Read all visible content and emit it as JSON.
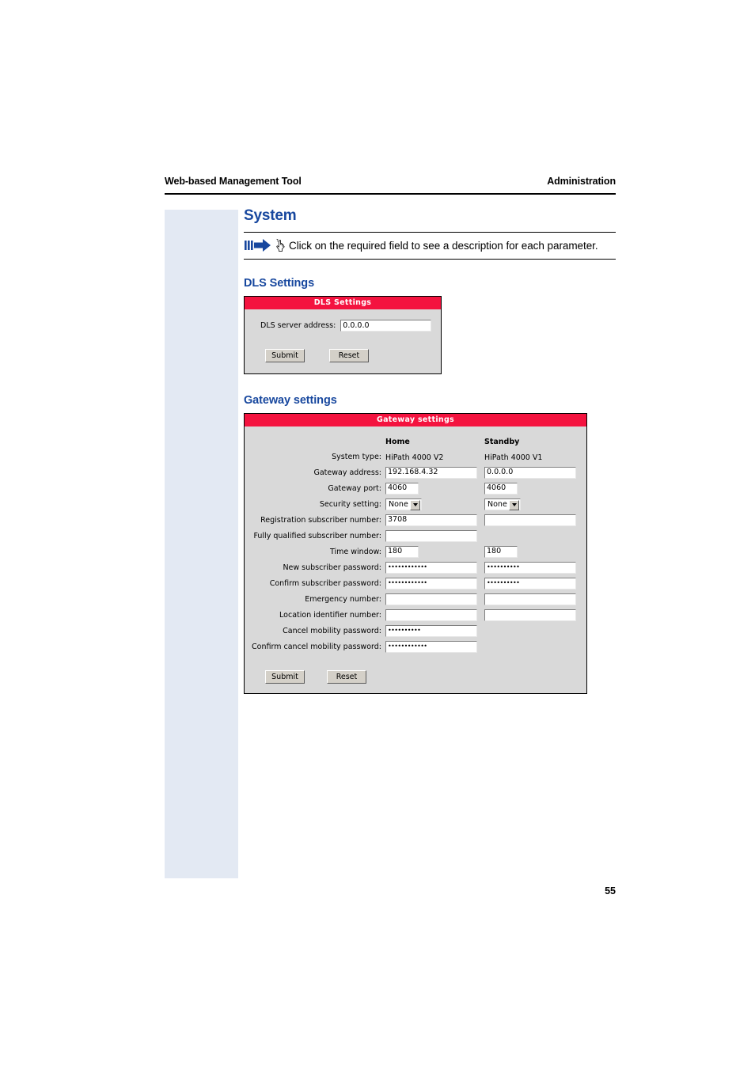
{
  "document": {
    "header_left": "Web-based Management Tool",
    "header_right": "Administration",
    "page_number": "55",
    "section_title": "System",
    "note_text": "Click on the required field to see a description for each parameter.",
    "note_icon": "arrow-bars-icon",
    "note_cursor_icon": "pointing-hand-cursor-icon",
    "accent_color": "#17479e",
    "panel_title_color": "#f4133f",
    "sidebar_color": "#e3e9f3"
  },
  "dls_section": {
    "heading": "DLS Settings",
    "panel_title": "DLS Settings",
    "fields": [
      {
        "label": "DLS server address:",
        "value": "0.0.0.0"
      }
    ],
    "buttons": {
      "submit": "Submit",
      "reset": "Reset"
    }
  },
  "gateway_section": {
    "heading": "Gateway settings",
    "panel_title": "Gateway settings",
    "columns": {
      "home": "Home",
      "standby": "Standby"
    },
    "rows": [
      {
        "label": "System type:",
        "type": "static",
        "home": "HiPath 4000 V2",
        "standby": "HiPath 4000 V1"
      },
      {
        "label": "Gateway address:",
        "type": "text",
        "width": "wide",
        "home": "192.168.4.32",
        "standby": "0.0.0.0"
      },
      {
        "label": "Gateway port:",
        "type": "text",
        "width": "narrow",
        "home": "4060",
        "standby": "4060"
      },
      {
        "label": "Security setting:",
        "type": "select",
        "home": "None",
        "standby": "None",
        "options": [
          "None"
        ]
      },
      {
        "label": "Registration subscriber number:",
        "type": "text",
        "width": "wide",
        "home": "3708",
        "standby": ""
      },
      {
        "label": "Fully qualified subscriber number:",
        "type": "text",
        "width": "wide",
        "home": "",
        "standby": null
      },
      {
        "label": "Time window:",
        "type": "text",
        "width": "narrow",
        "home": "180",
        "standby": "180"
      },
      {
        "label": "New subscriber password:",
        "type": "password",
        "width": "wide",
        "home": "••••••••••••",
        "standby": "••••••••••"
      },
      {
        "label": "Confirm subscriber password:",
        "type": "password",
        "width": "wide",
        "home": "••••••••••••",
        "standby": "••••••••••"
      },
      {
        "label": "Emergency number:",
        "type": "text",
        "width": "wide",
        "home": "",
        "standby": ""
      },
      {
        "label": "Location identifier number:",
        "type": "text",
        "width": "wide",
        "home": "",
        "standby": ""
      },
      {
        "label": "Cancel mobility password:",
        "type": "password",
        "width": "wide",
        "home": "••••••••••",
        "standby": null
      },
      {
        "label": "Confirm cancel mobility password:",
        "type": "password",
        "width": "wide",
        "home": "••••••••••••",
        "standby": null
      }
    ],
    "buttons": {
      "submit": "Submit",
      "reset": "Reset"
    }
  }
}
